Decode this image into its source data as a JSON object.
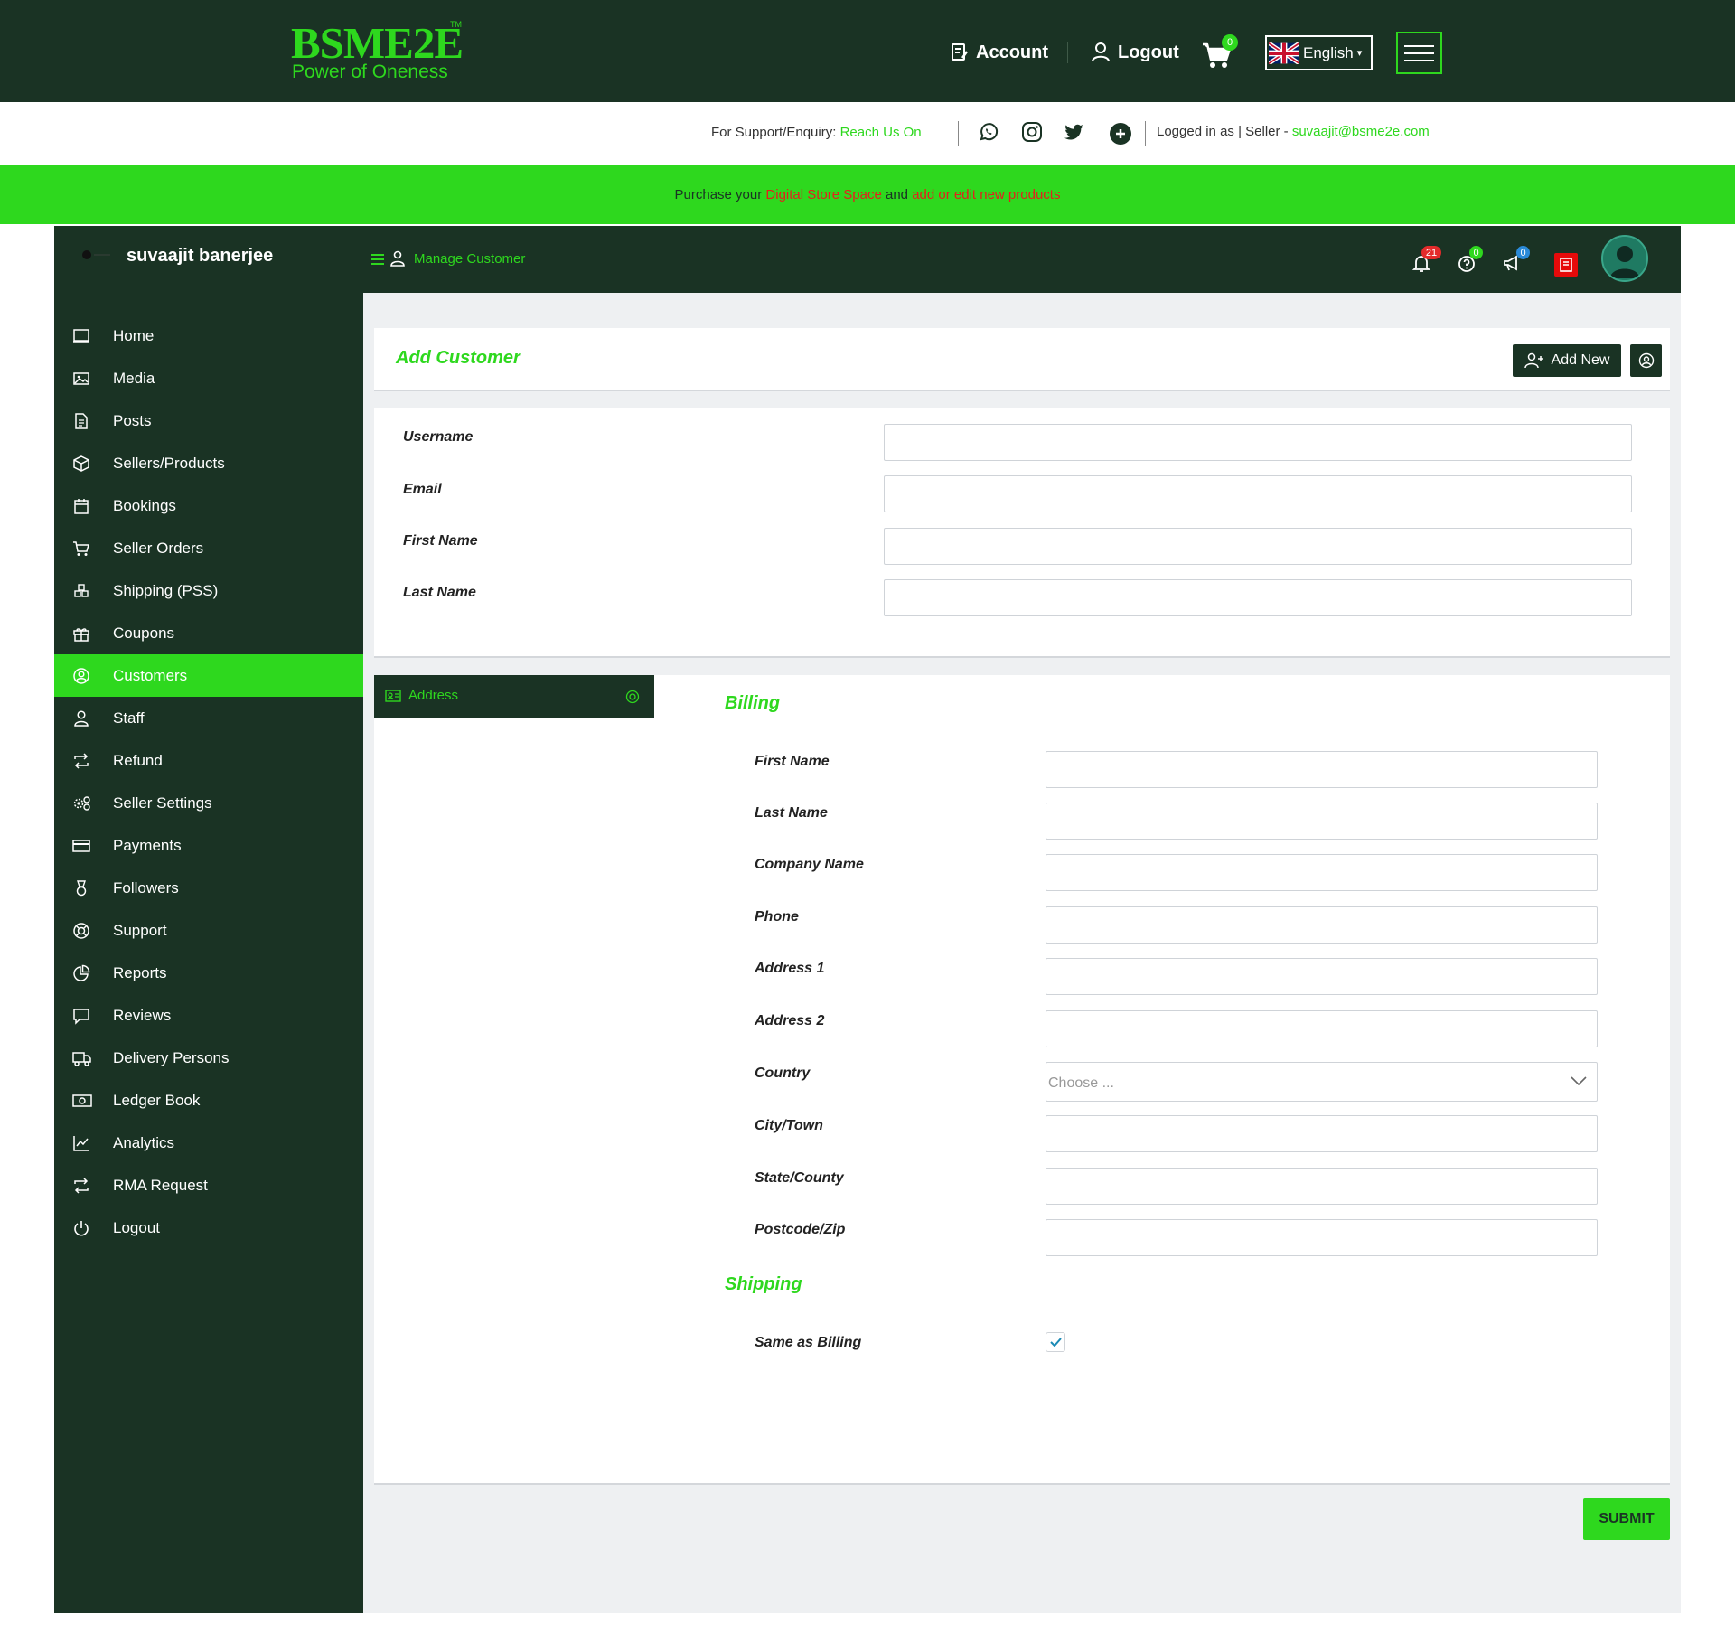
{
  "header": {
    "logo_main": "BSME2E",
    "logo_tm": "TM",
    "logo_tagline": "Power of Oneness",
    "account_label": "Account",
    "logout_label": "Logout",
    "cart_count": "0",
    "language": "English",
    "language_caret": "▾"
  },
  "support": {
    "prefix": "For Support/Enquiry:",
    "reach": "Reach Us On",
    "logged_prefix": "Logged in as | Seller -",
    "email": "suvaajit@bsme2e.com"
  },
  "promo": {
    "text1": "Purchase your",
    "link1": "Digital Store Space",
    "text2": "and",
    "link2": "add or edit new products"
  },
  "dashboard": {
    "user_name": "suvaajit banerjee",
    "breadcrumb": "Manage Customer",
    "notif_count": "21",
    "help_count": "0",
    "announce_count": "0"
  },
  "sidebar": {
    "items": [
      {
        "label": "Home"
      },
      {
        "label": "Media"
      },
      {
        "label": "Posts"
      },
      {
        "label": "Sellers/Products"
      },
      {
        "label": "Bookings"
      },
      {
        "label": "Seller Orders"
      },
      {
        "label": "Shipping (PSS)"
      },
      {
        "label": "Coupons"
      },
      {
        "label": "Customers"
      },
      {
        "label": "Staff"
      },
      {
        "label": "Refund"
      },
      {
        "label": "Seller Settings"
      },
      {
        "label": "Payments"
      },
      {
        "label": "Followers"
      },
      {
        "label": "Support"
      },
      {
        "label": "Reports"
      },
      {
        "label": "Reviews"
      },
      {
        "label": "Delivery Persons"
      },
      {
        "label": "Ledger Book"
      },
      {
        "label": "Analytics"
      },
      {
        "label": "RMA Request"
      },
      {
        "label": "Logout"
      }
    ]
  },
  "form": {
    "title": "Add Customer",
    "add_new_label": "Add New",
    "fields": [
      "Username",
      "Email",
      "First Name",
      "Last Name"
    ],
    "address_tab": "Address",
    "billing_title": "Billing",
    "billing_fields": [
      "First Name",
      "Last Name",
      "Company Name",
      "Phone",
      "Address 1",
      "Address 2",
      "Country",
      "City/Town",
      "State/County",
      "Postcode/Zip"
    ],
    "country_placeholder": "Choose ...",
    "shipping_title": "Shipping",
    "same_as_billing": "Same as Billing",
    "same_as_billing_checked": true,
    "submit_label": "SUBMIT"
  },
  "colors": {
    "brand_dark": "#1a3324",
    "brand_green": "#2ed81e",
    "promo_link": "#e3211c"
  }
}
